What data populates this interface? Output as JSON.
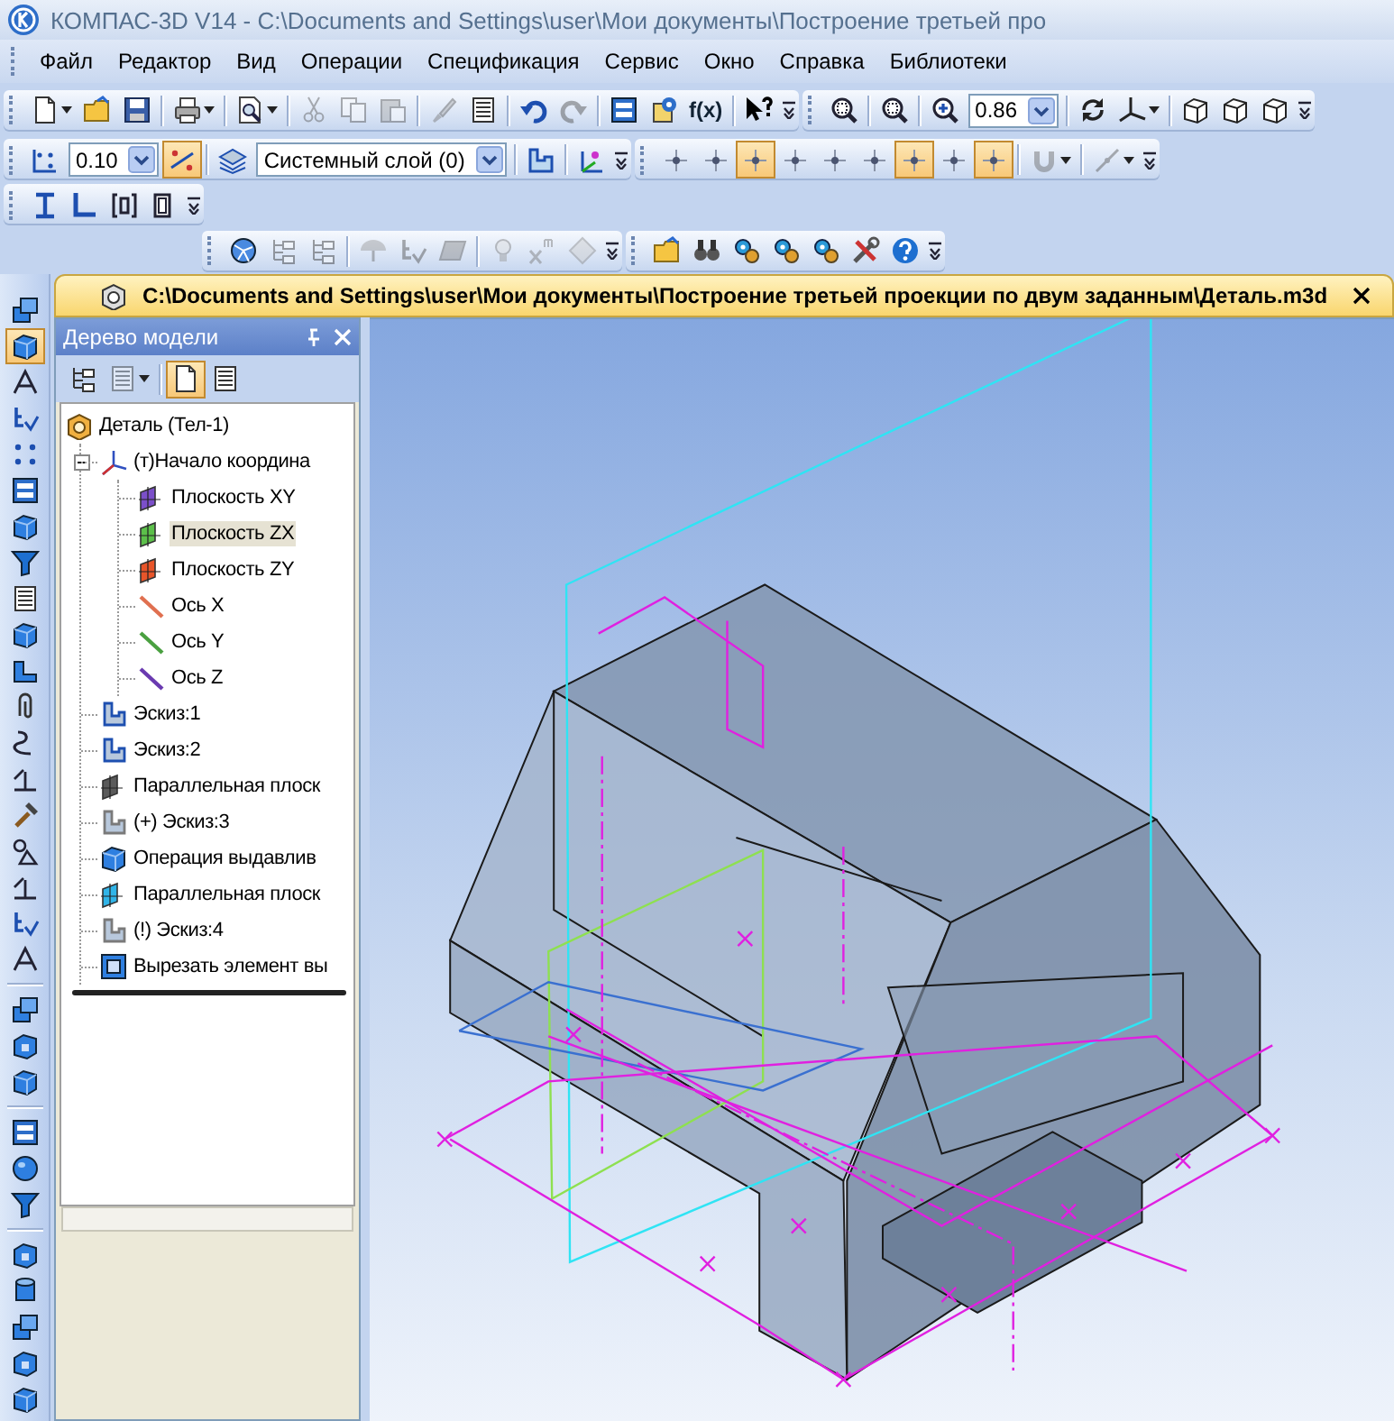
{
  "window": {
    "title": "КОМПАС-3D V14 - C:\\Documents and Settings\\user\\Мои документы\\Построение третьей про"
  },
  "menu": [
    {
      "label": "Файл"
    },
    {
      "label": "Редактор"
    },
    {
      "label": "Вид"
    },
    {
      "label": "Операции"
    },
    {
      "label": "Спецификация"
    },
    {
      "label": "Сервис"
    },
    {
      "label": "Окно"
    },
    {
      "label": "Справка"
    },
    {
      "label": "Библиотеки"
    }
  ],
  "toolbars": [
    {
      "groups": [
        {
          "items": [
            {
              "kind": "dropdown",
              "disabled": false
            },
            {
              "kind": "button",
              "disabled": false
            },
            {
              "kind": "button",
              "disabled": false
            },
            {
              "kind": "sep"
            },
            {
              "kind": "dropdown",
              "disabled": false
            },
            {
              "kind": "sep"
            },
            {
              "kind": "dropdown",
              "disabled": false
            },
            {
              "kind": "sep"
            },
            {
              "kind": "button",
              "disabled": true
            },
            {
              "kind": "button",
              "disabled": true
            },
            {
              "kind": "button",
              "disabled": true
            },
            {
              "kind": "sep"
            },
            {
              "kind": "button",
              "disabled": true
            },
            {
              "kind": "button",
              "disabled": false
            },
            {
              "kind": "sep"
            },
            {
              "kind": "button",
              "disabled": false
            },
            {
              "kind": "button",
              "disabled": true
            },
            {
              "kind": "sep"
            },
            {
              "kind": "button",
              "disabled": false
            },
            {
              "kind": "button",
              "disabled": false
            },
            {
              "kind": "label",
              "label": "f(x)"
            },
            {
              "kind": "sep"
            },
            {
              "kind": "button",
              "disabled": false
            }
          ]
        },
        {
          "items": [
            {
              "kind": "button",
              "disabled": false
            },
            {
              "kind": "sep"
            },
            {
              "kind": "button",
              "disabled": false
            },
            {
              "kind": "sep"
            },
            {
              "kind": "button",
              "disabled": false
            },
            {
              "kind": "combo",
              "value": "0.86"
            },
            {
              "kind": "sep"
            },
            {
              "kind": "button",
              "disabled": false
            },
            {
              "kind": "dropdown",
              "disabled": false
            },
            {
              "kind": "sep"
            },
            {
              "kind": "button",
              "disabled": false
            },
            {
              "kind": "button",
              "disabled": false
            },
            {
              "kind": "button",
              "disabled": false
            }
          ]
        }
      ]
    },
    {
      "groups": [
        {
          "items": [
            {
              "kind": "button",
              "disabled": false,
              "pressed": false
            },
            {
              "kind": "combo",
              "value": "0.10"
            },
            {
              "kind": "button",
              "disabled": false,
              "pressed": true
            },
            {
              "kind": "sep"
            },
            {
              "kind": "button",
              "disabled": false,
              "pressed": false
            },
            {
              "kind": "combo",
              "value": "Системный слой (0)"
            },
            {
              "kind": "sep"
            },
            {
              "kind": "button",
              "disabled": false,
              "pressed": false
            },
            {
              "kind": "sep"
            },
            {
              "kind": "button",
              "disabled": false,
              "pressed": false
            }
          ]
        },
        {
          "items": [
            {
              "kind": "button",
              "disabled": false,
              "pressed": false
            },
            {
              "kind": "button",
              "disabled": false,
              "pressed": false
            },
            {
              "kind": "button",
              "disabled": false,
              "pressed": true
            },
            {
              "kind": "button",
              "disabled": false,
              "pressed": false
            },
            {
              "kind": "button",
              "disabled": false,
              "pressed": false
            },
            {
              "kind": "button",
              "disabled": false,
              "pressed": false
            },
            {
              "kind": "button",
              "disabled": false,
              "pressed": true
            },
            {
              "kind": "button",
              "disabled": false,
              "pressed": false
            },
            {
              "kind": "button",
              "disabled": false,
              "pressed": true
            },
            {
              "kind": "sep"
            },
            {
              "kind": "dropdown",
              "disabled": true,
              "pressed": false
            },
            {
              "kind": "sep"
            },
            {
              "kind": "dropdown",
              "disabled": true,
              "pressed": false
            }
          ]
        }
      ]
    },
    {
      "groups": [
        {
          "items": [
            {
              "kind": "button",
              "disabled": false
            },
            {
              "kind": "button",
              "disabled": false
            },
            {
              "kind": "button",
              "disabled": false
            },
            {
              "kind": "button",
              "disabled": false
            }
          ]
        }
      ]
    },
    {
      "groups": [
        {
          "items": [
            {
              "kind": "button",
              "disabled": false
            },
            {
              "kind": "button",
              "disabled": true
            },
            {
              "kind": "button",
              "disabled": true
            },
            {
              "kind": "sep"
            },
            {
              "kind": "button",
              "disabled": true
            },
            {
              "kind": "button",
              "disabled": true
            },
            {
              "kind": "button",
              "disabled": true
            },
            {
              "kind": "sep"
            },
            {
              "kind": "button",
              "disabled": true
            },
            {
              "kind": "button",
              "disabled": true
            },
            {
              "kind": "button",
              "disabled": true
            }
          ]
        },
        {
          "items": [
            {
              "kind": "button",
              "disabled": false
            },
            {
              "kind": "button",
              "disabled": false
            },
            {
              "kind": "button",
              "disabled": false
            },
            {
              "kind": "button",
              "disabled": false
            },
            {
              "kind": "button",
              "disabled": false
            },
            {
              "kind": "button",
              "disabled": false
            },
            {
              "kind": "button",
              "disabled": false
            }
          ]
        }
      ]
    }
  ],
  "side_toolbar": {
    "items": [
      {
        "kind": "button",
        "pressed": false
      },
      {
        "kind": "button",
        "pressed": true
      },
      {
        "kind": "button",
        "pressed": false
      },
      {
        "kind": "button",
        "pressed": false
      },
      {
        "kind": "button",
        "pressed": false
      },
      {
        "kind": "button",
        "pressed": false
      },
      {
        "kind": "button",
        "pressed": false
      },
      {
        "kind": "button",
        "pressed": false
      },
      {
        "kind": "button",
        "pressed": false
      },
      {
        "kind": "button",
        "pressed": false
      },
      {
        "kind": "button",
        "pressed": false
      },
      {
        "kind": "button",
        "pressed": false
      },
      {
        "kind": "button",
        "pressed": false
      },
      {
        "kind": "button",
        "pressed": false
      },
      {
        "kind": "button",
        "pressed": false
      },
      {
        "kind": "button",
        "pressed": false
      },
      {
        "kind": "button",
        "pressed": false
      },
      {
        "kind": "button",
        "pressed": false
      },
      {
        "kind": "button",
        "pressed": false
      },
      {
        "kind": "sep"
      },
      {
        "kind": "button",
        "pressed": false
      },
      {
        "kind": "button",
        "pressed": false
      },
      {
        "kind": "button",
        "pressed": false
      },
      {
        "kind": "sep"
      },
      {
        "kind": "button",
        "pressed": false
      },
      {
        "kind": "button",
        "pressed": false
      },
      {
        "kind": "button",
        "pressed": false
      },
      {
        "kind": "sep"
      },
      {
        "kind": "button",
        "pressed": false
      },
      {
        "kind": "button",
        "pressed": false
      },
      {
        "kind": "button",
        "pressed": false
      },
      {
        "kind": "button",
        "pressed": false
      },
      {
        "kind": "button",
        "pressed": false
      }
    ]
  },
  "document_tab": {
    "title": "C:\\Documents and Settings\\user\\Мои документы\\Построение третьей проекции по двум заданным\\Деталь.m3d"
  },
  "tree_panel": {
    "title": "Дерево модели",
    "toolbar": [
      {
        "kind": "button",
        "disabled": false,
        "pressed": false
      },
      {
        "kind": "dropdown",
        "disabled": true,
        "pressed": false
      },
      {
        "kind": "sep"
      },
      {
        "kind": "button",
        "disabled": false,
        "pressed": true
      },
      {
        "kind": "button",
        "disabled": false,
        "pressed": false
      }
    ],
    "tree": [
      {
        "label": "Деталь (Тел-1)",
        "kind": "part",
        "selected": false,
        "children": [
          {
            "label": "(т)Начало координа",
            "kind": "origin",
            "selected": false,
            "expanded": true,
            "children": [
              {
                "label": "Плоскость XY",
                "kind": "plane",
                "color": "#7b4fc9",
                "selected": false
              },
              {
                "label": "Плоскость ZX",
                "kind": "plane",
                "color": "#5cc04a",
                "selected": true
              },
              {
                "label": "Плоскость ZY",
                "kind": "plane",
                "color": "#e8552a",
                "selected": false
              },
              {
                "label": "Ось X",
                "kind": "axis",
                "color": "#e07050",
                "selected": false
              },
              {
                "label": "Ось Y",
                "kind": "axis",
                "color": "#4aa040",
                "selected": false
              },
              {
                "label": "Ось Z",
                "kind": "axis",
                "color": "#6a3ab0",
                "selected": false
              }
            ]
          },
          {
            "label": "Эскиз:1",
            "kind": "sketch",
            "color": "#1d4fb0",
            "selected": false
          },
          {
            "label": "Эскиз:2",
            "kind": "sketch",
            "color": "#1d4fb0",
            "selected": false
          },
          {
            "label": "Параллельная плоск",
            "kind": "plane",
            "color": "#5a5a5a",
            "selected": false
          },
          {
            "label": "(+) Эскиз:3",
            "kind": "sketch",
            "color": "#7a7a7a",
            "selected": false
          },
          {
            "label": "Операция выдавлив",
            "kind": "extrude",
            "selected": false
          },
          {
            "label": "Параллельная плоск",
            "kind": "plane",
            "color": "#30b4e8",
            "selected": false
          },
          {
            "label": "(!) Эскиз:4",
            "kind": "sketch",
            "color": "#7a7a7a",
            "selected": false
          },
          {
            "label": "Вырезать элемент вы",
            "kind": "cut",
            "selected": false
          }
        ]
      }
    ]
  }
}
